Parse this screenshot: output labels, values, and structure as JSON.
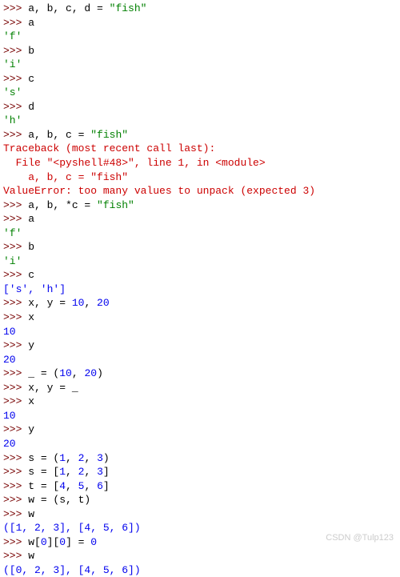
{
  "lines": [
    {
      "segs": [
        {
          "c": "prompt",
          "t": ">>> "
        },
        {
          "c": "plain",
          "t": "a, b, c, d = "
        },
        {
          "c": "str",
          "t": "\"fish\""
        }
      ]
    },
    {
      "segs": [
        {
          "c": "prompt",
          "t": ">>> "
        },
        {
          "c": "plain",
          "t": "a"
        }
      ]
    },
    {
      "segs": [
        {
          "c": "str",
          "t": "'f'"
        }
      ]
    },
    {
      "segs": [
        {
          "c": "prompt",
          "t": ">>> "
        },
        {
          "c": "plain",
          "t": "b"
        }
      ]
    },
    {
      "segs": [
        {
          "c": "str",
          "t": "'i'"
        }
      ]
    },
    {
      "segs": [
        {
          "c": "prompt",
          "t": ">>> "
        },
        {
          "c": "plain",
          "t": "c"
        }
      ]
    },
    {
      "segs": [
        {
          "c": "str",
          "t": "'s'"
        }
      ]
    },
    {
      "segs": [
        {
          "c": "prompt",
          "t": ">>> "
        },
        {
          "c": "plain",
          "t": "d"
        }
      ]
    },
    {
      "segs": [
        {
          "c": "str",
          "t": "'h'"
        }
      ]
    },
    {
      "segs": [
        {
          "c": "prompt",
          "t": ">>> "
        },
        {
          "c": "plain",
          "t": "a, b, c = "
        },
        {
          "c": "str",
          "t": "\"fish\""
        }
      ]
    },
    {
      "segs": [
        {
          "c": "err",
          "t": "Traceback (most recent call last):"
        }
      ]
    },
    {
      "segs": [
        {
          "c": "err",
          "t": "  File \"<pyshell#48>\", line 1, in <module>"
        }
      ]
    },
    {
      "segs": [
        {
          "c": "err",
          "t": "    a, b, c = \"fish\""
        }
      ]
    },
    {
      "segs": [
        {
          "c": "err",
          "t": "ValueError: too many values to unpack (expected 3)"
        }
      ]
    },
    {
      "segs": [
        {
          "c": "prompt",
          "t": ">>> "
        },
        {
          "c": "plain",
          "t": "a, b, *c = "
        },
        {
          "c": "str",
          "t": "\"fish\""
        }
      ]
    },
    {
      "segs": [
        {
          "c": "prompt",
          "t": ">>> "
        },
        {
          "c": "plain",
          "t": "a"
        }
      ]
    },
    {
      "segs": [
        {
          "c": "str",
          "t": "'f'"
        }
      ]
    },
    {
      "segs": [
        {
          "c": "prompt",
          "t": ">>> "
        },
        {
          "c": "plain",
          "t": "b"
        }
      ]
    },
    {
      "segs": [
        {
          "c": "str",
          "t": "'i'"
        }
      ]
    },
    {
      "segs": [
        {
          "c": "prompt",
          "t": ">>> "
        },
        {
          "c": "plain",
          "t": "c"
        }
      ]
    },
    {
      "segs": [
        {
          "c": "num",
          "t": "['s', 'h']"
        }
      ]
    },
    {
      "segs": [
        {
          "c": "prompt",
          "t": ">>> "
        },
        {
          "c": "plain",
          "t": "x, y = "
        },
        {
          "c": "num",
          "t": "10"
        },
        {
          "c": "plain",
          "t": ", "
        },
        {
          "c": "num",
          "t": "20"
        }
      ]
    },
    {
      "segs": [
        {
          "c": "prompt",
          "t": ">>> "
        },
        {
          "c": "plain",
          "t": "x"
        }
      ]
    },
    {
      "segs": [
        {
          "c": "num",
          "t": "10"
        }
      ]
    },
    {
      "segs": [
        {
          "c": "prompt",
          "t": ">>> "
        },
        {
          "c": "plain",
          "t": "y"
        }
      ]
    },
    {
      "segs": [
        {
          "c": "num",
          "t": "20"
        }
      ]
    },
    {
      "segs": [
        {
          "c": "prompt",
          "t": ">>> "
        },
        {
          "c": "plain",
          "t": "_ = ("
        },
        {
          "c": "num",
          "t": "10"
        },
        {
          "c": "plain",
          "t": ", "
        },
        {
          "c": "num",
          "t": "20"
        },
        {
          "c": "plain",
          "t": ")"
        }
      ]
    },
    {
      "segs": [
        {
          "c": "prompt",
          "t": ">>> "
        },
        {
          "c": "plain",
          "t": "x, y = _"
        }
      ]
    },
    {
      "segs": [
        {
          "c": "prompt",
          "t": ">>> "
        },
        {
          "c": "plain",
          "t": "x"
        }
      ]
    },
    {
      "segs": [
        {
          "c": "num",
          "t": "10"
        }
      ]
    },
    {
      "segs": [
        {
          "c": "prompt",
          "t": ">>> "
        },
        {
          "c": "plain",
          "t": "y"
        }
      ]
    },
    {
      "segs": [
        {
          "c": "num",
          "t": "20"
        }
      ]
    },
    {
      "segs": [
        {
          "c": "prompt",
          "t": ">>> "
        },
        {
          "c": "plain",
          "t": "s = ("
        },
        {
          "c": "num",
          "t": "1"
        },
        {
          "c": "plain",
          "t": ", "
        },
        {
          "c": "num",
          "t": "2"
        },
        {
          "c": "plain",
          "t": ", "
        },
        {
          "c": "num",
          "t": "3"
        },
        {
          "c": "plain",
          "t": ")"
        }
      ]
    },
    {
      "segs": [
        {
          "c": "prompt",
          "t": ">>> "
        },
        {
          "c": "plain",
          "t": "s = ["
        },
        {
          "c": "num",
          "t": "1"
        },
        {
          "c": "plain",
          "t": ", "
        },
        {
          "c": "num",
          "t": "2"
        },
        {
          "c": "plain",
          "t": ", "
        },
        {
          "c": "num",
          "t": "3"
        },
        {
          "c": "plain",
          "t": "]"
        }
      ]
    },
    {
      "segs": [
        {
          "c": "prompt",
          "t": ">>> "
        },
        {
          "c": "plain",
          "t": "t = ["
        },
        {
          "c": "num",
          "t": "4"
        },
        {
          "c": "plain",
          "t": ", "
        },
        {
          "c": "num",
          "t": "5"
        },
        {
          "c": "plain",
          "t": ", "
        },
        {
          "c": "num",
          "t": "6"
        },
        {
          "c": "plain",
          "t": "]"
        }
      ]
    },
    {
      "segs": [
        {
          "c": "prompt",
          "t": ">>> "
        },
        {
          "c": "plain",
          "t": "w = (s, t)"
        }
      ]
    },
    {
      "segs": [
        {
          "c": "prompt",
          "t": ">>> "
        },
        {
          "c": "plain",
          "t": "w"
        }
      ]
    },
    {
      "segs": [
        {
          "c": "num",
          "t": "([1, 2, 3], [4, 5, 6])"
        }
      ]
    },
    {
      "segs": [
        {
          "c": "prompt",
          "t": ">>> "
        },
        {
          "c": "plain",
          "t": "w["
        },
        {
          "c": "num",
          "t": "0"
        },
        {
          "c": "plain",
          "t": "]["
        },
        {
          "c": "num",
          "t": "0"
        },
        {
          "c": "plain",
          "t": "] = "
        },
        {
          "c": "num",
          "t": "0"
        }
      ]
    },
    {
      "segs": [
        {
          "c": "prompt",
          "t": ">>> "
        },
        {
          "c": "plain",
          "t": "w"
        }
      ]
    },
    {
      "segs": [
        {
          "c": "num",
          "t": "([0, 2, 3], [4, 5, 6])"
        }
      ]
    }
  ],
  "watermark": "CSDN @Tulp123"
}
